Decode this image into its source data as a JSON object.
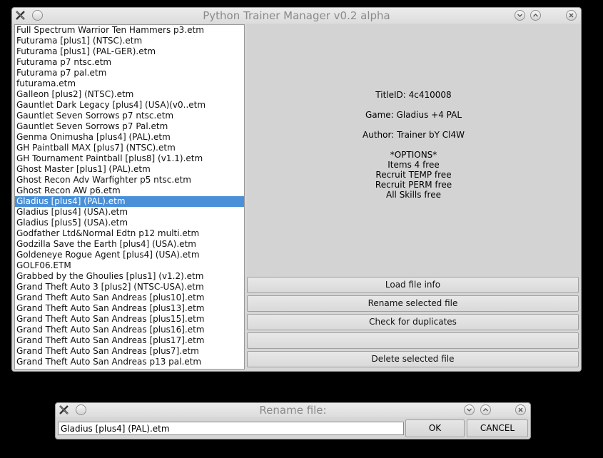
{
  "main_window": {
    "title": "Python Trainer Manager v0.2 alpha",
    "files": [
      "Full Spectrum Warrior Ten Hammers p3.etm",
      "Futurama [plus1] (NTSC).etm",
      "Futurama [plus1] (PAL-GER).etm",
      "Futurama p7 ntsc.etm",
      "Futurama p7 pal.etm",
      "futurama.etm",
      "Galleon [plus2] (NTSC).etm",
      "Gauntlet Dark Legacy [plus4] (USA)(v0..etm",
      "Gauntlet Seven Sorrows p7 ntsc.etm",
      "Gauntlet Seven Sorrows p7 Pal.etm",
      "Genma Onimusha [plus4] (PAL).etm",
      "GH Paintball MAX [plus7] (NTSC).etm",
      "GH Tournament Paintball [plus8] (v1.1).etm",
      "Ghost Master [plus1] (PAL).etm",
      "Ghost Recon Adv Warfighter p5 ntsc.etm",
      "Ghost Recon AW p6.etm",
      "Gladius [plus4] (PAL).etm",
      "Gladius [plus4] (USA).etm",
      "Gladius [plus5] (USA).etm",
      "Godfather Ltd&Normal Edtn p12 multi.etm",
      "Godzilla Save the Earth [plus4] (USA).etm",
      "Goldeneye Rogue Agent [plus4] (USA).etm",
      "GOLF06.ETM",
      "Grabbed by the Ghoulies [plus1] (v1.2).etm",
      "Grand Theft Auto 3 [plus2] (NTSC-USA).etm",
      "Grand Theft Auto San Andreas [plus10].etm",
      "Grand Theft Auto San Andreas [plus13].etm",
      "Grand Theft Auto San Andreas [plus15].etm",
      "Grand Theft Auto San Andreas [plus16].etm",
      "Grand Theft Auto San Andreas [plus17].etm",
      "Grand Theft Auto San Andreas [plus7].etm",
      "Grand Theft Auto San Andreas p13 pal.etm"
    ],
    "selected_file": "Gladius [plus4] (PAL).etm",
    "info": {
      "title_id": "TitleID: 4c410008",
      "game": "Game: Gladius +4 PAL",
      "author": "Author: Trainer bY Cl4W",
      "options_header": "*OPTIONS*",
      "options": [
        "Items 4 free",
        "Recruit TEMP free",
        "Recruit PERM free",
        "All Skills free"
      ]
    },
    "buttons": {
      "load": "Load file info",
      "rename": "Rename selected file",
      "duplicates": "Check for duplicates",
      "blank": "",
      "delete": "Delete selected file"
    }
  },
  "rename_dialog": {
    "title": "Rename file:",
    "input_value": "Gladius [plus4] (PAL).etm",
    "ok_label": "OK",
    "cancel_label": "CANCEL"
  },
  "titlebar_icons": {
    "app": "x-app-icon",
    "minimize": "minimize-icon",
    "chevron_down": "chevron-down-icon",
    "chevron_up": "chevron-up-icon",
    "close": "close-icon"
  },
  "colors": {
    "selection": "#4a90d9",
    "window_bg": "#d6d6d6",
    "desktop_bg": "#000000"
  }
}
